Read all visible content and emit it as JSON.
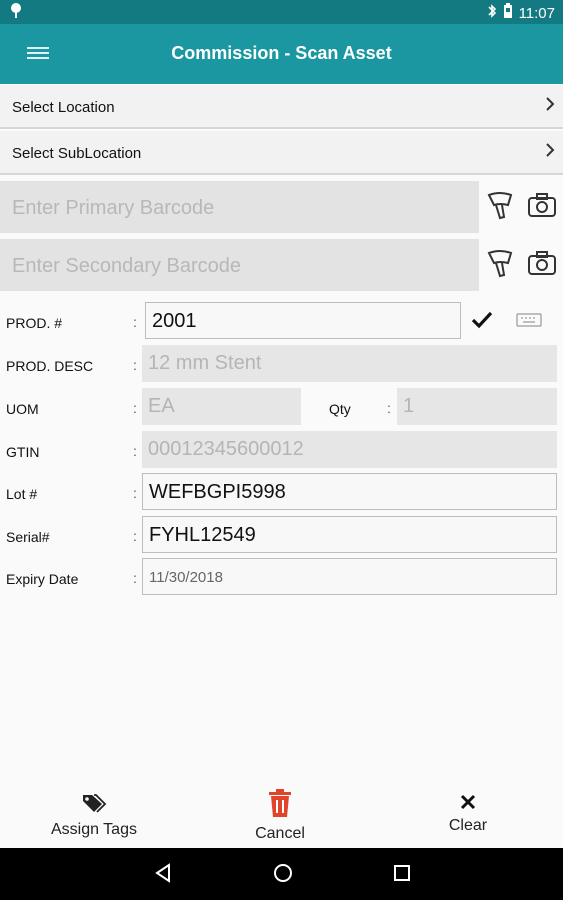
{
  "status_bar": {
    "time": "11:07",
    "icons": [
      "location-pin-icon",
      "bluetooth-icon",
      "battery-icon"
    ]
  },
  "app_bar": {
    "title": "Commission - Scan Asset",
    "menu_icon": "hamburger-menu-icon"
  },
  "location": {
    "label": "Select Location"
  },
  "sublocation": {
    "label": "Select SubLocation"
  },
  "primary_barcode": {
    "placeholder": "Enter Primary Barcode"
  },
  "secondary_barcode": {
    "placeholder": "Enter Secondary Barcode"
  },
  "form": {
    "prod_no": {
      "label": "PROD. #",
      "value": "2001"
    },
    "prod_desc": {
      "label": "PROD. DESC",
      "value": "12 mm Stent"
    },
    "uom": {
      "label": "UOM",
      "value": "EA"
    },
    "qty": {
      "label": "Qty",
      "value": "1"
    },
    "gtin": {
      "label": "GTIN",
      "value": "00012345600012"
    },
    "lot": {
      "label": "Lot #",
      "value": "WEFBGPI5998"
    },
    "serial": {
      "label": "Serial#",
      "value": "FYHL12549"
    },
    "expiry": {
      "label": "Expiry Date",
      "value": "11/30/2018"
    },
    "colon": ":"
  },
  "actions": {
    "assign_tags": "Assign Tags",
    "cancel": "Cancel",
    "clear": "Clear"
  },
  "colors": {
    "primary": "#1a97a0",
    "status": "#137a82",
    "cancel": "#e0452b"
  }
}
